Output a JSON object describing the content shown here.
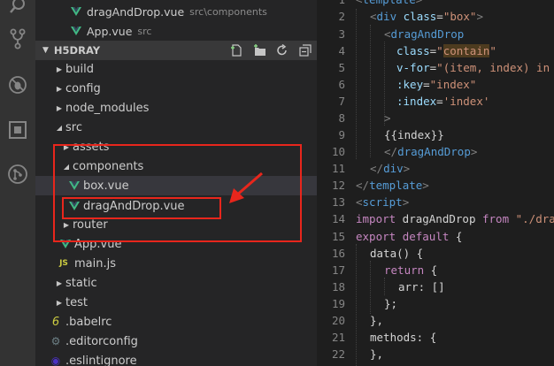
{
  "open_editors": [
    {
      "name": "dragAndDrop.vue",
      "path": "src\\components"
    },
    {
      "name": "App.vue",
      "path": "src"
    }
  ],
  "explorer": {
    "project": "H5DRAY",
    "actions": [
      "new-file-icon",
      "new-folder-icon",
      "refresh-icon",
      "collapse-all-icon"
    ]
  },
  "tree": {
    "build": "build",
    "config": "config",
    "node_modules": "node_modules",
    "src": "src",
    "assets": "assets",
    "components": "components",
    "box": "box.vue",
    "dragAndDrop": "dragAndDrop.vue",
    "router": "router",
    "app": "App.vue",
    "main": "main.js",
    "static": "static",
    "test": "test",
    "babelrc": ".babelrc",
    "editorconfig": ".editorconfig",
    "eslintignore": ".eslintignore"
  },
  "line_numbers": [
    "1",
    "2",
    "3",
    "4",
    "5",
    "6",
    "7",
    "8",
    "9",
    "10",
    "11",
    "12",
    "13",
    "14",
    "15",
    "16",
    "17",
    "18",
    "19",
    "20",
    "21",
    "22"
  ],
  "code": {
    "l1": {
      "a": "<",
      "b": "template",
      "c": ">"
    },
    "l2": {
      "a": "<",
      "b": "div",
      "c": "class",
      "d": "=",
      "e": "\"box\"",
      "f": ">"
    },
    "l3": {
      "a": "<",
      "b": "dragAndDrop"
    },
    "l4": {
      "a": "class",
      "b": "=",
      "c": "\"",
      "d": "contain",
      "e": "\""
    },
    "l5": {
      "a": "v-for",
      "b": "=",
      "c": "\"(item, index) in"
    },
    "l6": {
      "a": ":key",
      "b": "=",
      "c": "\"index\""
    },
    "l7": {
      "a": ":index",
      "b": "=",
      "c": "'index'"
    },
    "l8": {
      "a": ">"
    },
    "l9": {
      "a": "{{index}}"
    },
    "l10": {
      "a": "</",
      "b": "dragAndDrop",
      "c": ">"
    },
    "l11": {
      "a": "</",
      "b": "div",
      "c": ">"
    },
    "l12": {
      "a": "</",
      "b": "template",
      "c": ">"
    },
    "l13": {
      "a": "<",
      "b": "script",
      "c": ">"
    },
    "l14": {
      "a": "import",
      "b": " dragAndDrop ",
      "c": "from",
      "d": " \"./dra"
    },
    "l15": {
      "a": "export",
      "b": " ",
      "c": "default",
      "d": " {"
    },
    "l16": {
      "a": "data() {"
    },
    "l17": {
      "a": "return",
      "b": " {"
    },
    "l18": {
      "a": "arr: []"
    },
    "l19": {
      "a": "};"
    },
    "l20": {
      "a": "},"
    },
    "l21": {
      "a": "methods: {"
    },
    "l22": {
      "a": "},"
    }
  },
  "colors": {
    "annotation": "#e8261c",
    "vue_green": "#41b883",
    "vue_dark": "#35495e"
  }
}
